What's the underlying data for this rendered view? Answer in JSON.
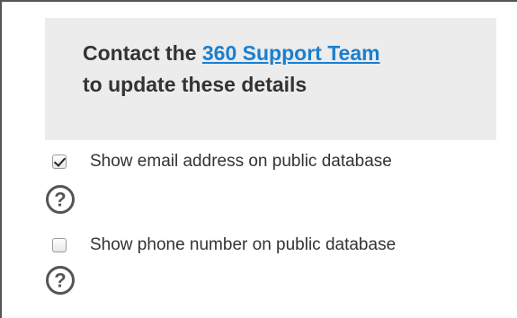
{
  "notice": {
    "text_before": "Contact the ",
    "link_text": "360 Support Team",
    "text_after": "to update these details"
  },
  "options": {
    "email": {
      "label": "Show email address on public database",
      "checked": true
    },
    "phone": {
      "label": "Show phone number on public database",
      "checked": false
    }
  },
  "icons": {
    "help": "question-circle-icon"
  },
  "colors": {
    "link": "#1a7fd0",
    "notice_background": "#ececec",
    "text": "#333333"
  }
}
